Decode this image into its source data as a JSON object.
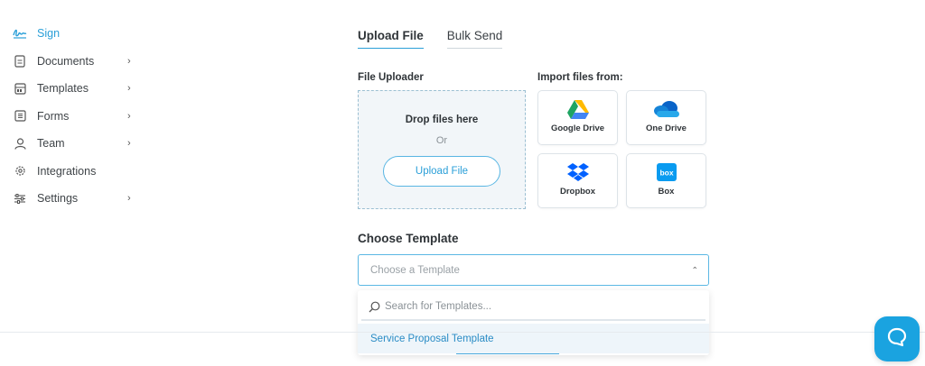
{
  "sidebar": {
    "items": [
      {
        "label": "Sign",
        "icon": "signature-icon",
        "active": true,
        "has_chevron": false
      },
      {
        "label": "Documents",
        "icon": "document-icon",
        "active": false,
        "has_chevron": true
      },
      {
        "label": "Templates",
        "icon": "template-icon",
        "active": false,
        "has_chevron": true
      },
      {
        "label": "Forms",
        "icon": "form-icon",
        "active": false,
        "has_chevron": true
      },
      {
        "label": "Team",
        "icon": "user-icon",
        "active": false,
        "has_chevron": true
      },
      {
        "label": "Integrations",
        "icon": "gear-icon",
        "active": false,
        "has_chevron": false
      },
      {
        "label": "Settings",
        "icon": "sliders-icon",
        "active": false,
        "has_chevron": true
      }
    ]
  },
  "tabs": [
    {
      "label": "Upload File",
      "active": true
    },
    {
      "label": "Bulk Send",
      "active": false
    }
  ],
  "uploader": {
    "title": "File Uploader",
    "drop_text": "Drop files here",
    "or_text": "Or",
    "button_label": "Upload File"
  },
  "import": {
    "title": "Import files from:",
    "sources": [
      {
        "label": "Google Drive",
        "icon": "google-drive-icon"
      },
      {
        "label": "One Drive",
        "icon": "onedrive-icon"
      },
      {
        "label": "Dropbox",
        "icon": "dropbox-icon"
      },
      {
        "label": "Box",
        "icon": "box-icon"
      }
    ]
  },
  "template": {
    "title": "Choose Template",
    "placeholder": "Choose a Template",
    "search_placeholder": "Search for Templates...",
    "options": [
      "Service Proposal Template"
    ]
  },
  "colors": {
    "accent": "#2a9fd8",
    "chat_button": "#1aa3e0",
    "uploader_bg": "#f2f6f9"
  }
}
